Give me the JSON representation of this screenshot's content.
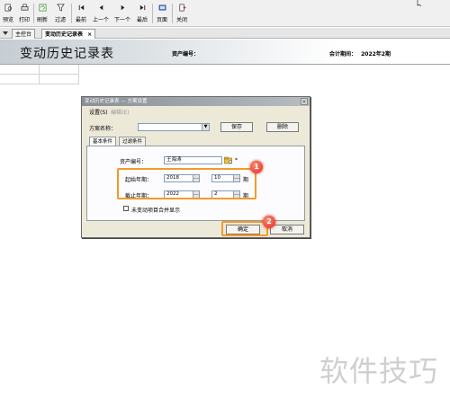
{
  "toolbar": {
    "buttons": [
      {
        "label": "预览",
        "icon": "preview-icon"
      },
      {
        "label": "打印",
        "icon": "print-icon"
      },
      {
        "label": "刷新",
        "icon": "refresh-icon"
      },
      {
        "label": "过滤",
        "icon": "filter-icon"
      },
      {
        "label": "最前",
        "icon": "first-icon"
      },
      {
        "label": "上一个",
        "icon": "prev-icon"
      },
      {
        "label": "下一个",
        "icon": "next-icon"
      },
      {
        "label": "最后",
        "icon": "last-icon"
      },
      {
        "label": "页面",
        "icon": "page-icon"
      },
      {
        "label": "关闭",
        "icon": "close-icon"
      }
    ]
  },
  "tabs": {
    "home": "主控台",
    "active": "变动历史记录表",
    "close_glyph": "×"
  },
  "report": {
    "title": "变动历史记录表",
    "asset_code_label": "资产编号：",
    "period_label": "会计期间：",
    "period_value": "2022年2期"
  },
  "dialog": {
    "title": "变动历史记录表 — 方案设置",
    "close_glyph": "×",
    "menu": {
      "settings": "设置(S)",
      "edit": "编辑(E)"
    },
    "scheme_label": "方案名称：",
    "scheme_value": "",
    "save_label": "保存",
    "delete_label": "删除",
    "tabs": {
      "basic": "基本条件",
      "filter": "过滤条件"
    },
    "asset_code_label": "资产编号：",
    "asset_code_value": "王海涛",
    "required_mark": "*",
    "start_label": "起始年期：",
    "start_year": "2018",
    "start_period": "10",
    "end_label": "截止年期：",
    "end_year": "2022",
    "end_period": "2",
    "period_unit": "期",
    "merge_label": "未变动项目合并显示",
    "ok_label": "确定",
    "cancel_label": "取消"
  },
  "annotations": {
    "step1": "1",
    "step2": "2"
  },
  "watermark": "软件技巧",
  "colors": {
    "highlight": "#f39a2a",
    "badge": "#e8473a",
    "field_border": "#7f9db9"
  }
}
